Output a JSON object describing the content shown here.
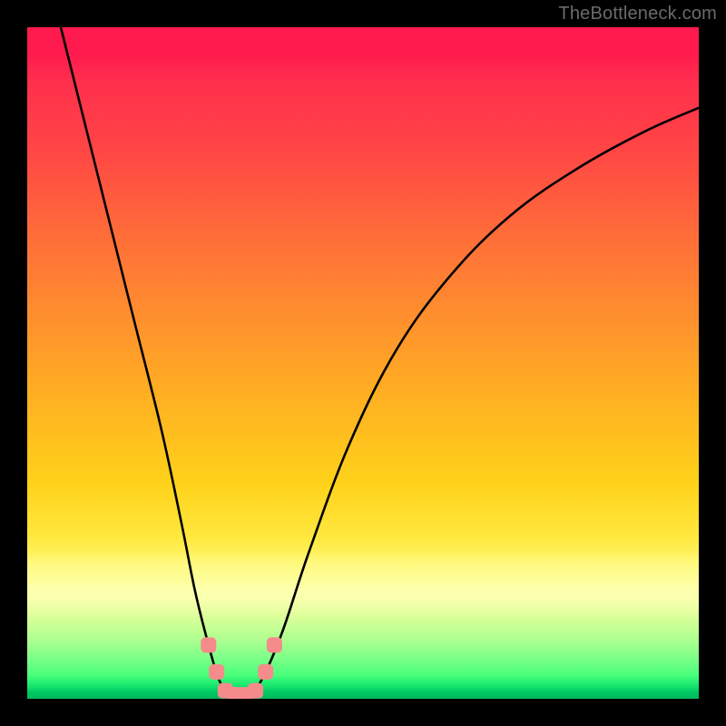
{
  "watermark": "TheBottleneck.com",
  "chart_data": {
    "type": "line",
    "title": "",
    "xlabel": "",
    "ylabel": "",
    "xlim": [
      0,
      100
    ],
    "ylim": [
      0,
      100
    ],
    "grid": false,
    "legend": false,
    "background_gradient": {
      "top": "#ff1a4d",
      "upper_mid": "#ff8c2f",
      "mid": "#ffd21a",
      "lower_mid": "#f4ffa0",
      "bottom": "#00c864"
    },
    "series": [
      {
        "name": "bottleneck-curve",
        "color": "#000000",
        "x": [
          5,
          8,
          12,
          16,
          20,
          23,
          25,
          27,
          28.5,
          30,
          31.5,
          33,
          35,
          38,
          42,
          48,
          55,
          63,
          72,
          82,
          92,
          100
        ],
        "y": [
          100,
          88,
          72,
          56,
          40,
          26,
          16,
          8,
          3,
          0.5,
          0.2,
          0.5,
          3,
          10,
          22,
          38,
          52,
          63,
          72,
          79,
          84.5,
          88
        ]
      }
    ],
    "markers": [
      {
        "name": "bottleneck-markers",
        "color": "#f58b8b",
        "shape": "rounded-square",
        "points": [
          {
            "x": 27.0,
            "y": 8
          },
          {
            "x": 28.2,
            "y": 4
          },
          {
            "x": 29.5,
            "y": 1.2
          },
          {
            "x": 31.0,
            "y": 0.6
          },
          {
            "x": 32.5,
            "y": 0.6
          },
          {
            "x": 34.0,
            "y": 1.2
          },
          {
            "x": 35.5,
            "y": 4
          },
          {
            "x": 36.8,
            "y": 8
          }
        ]
      }
    ],
    "optimum_x": 31
  }
}
